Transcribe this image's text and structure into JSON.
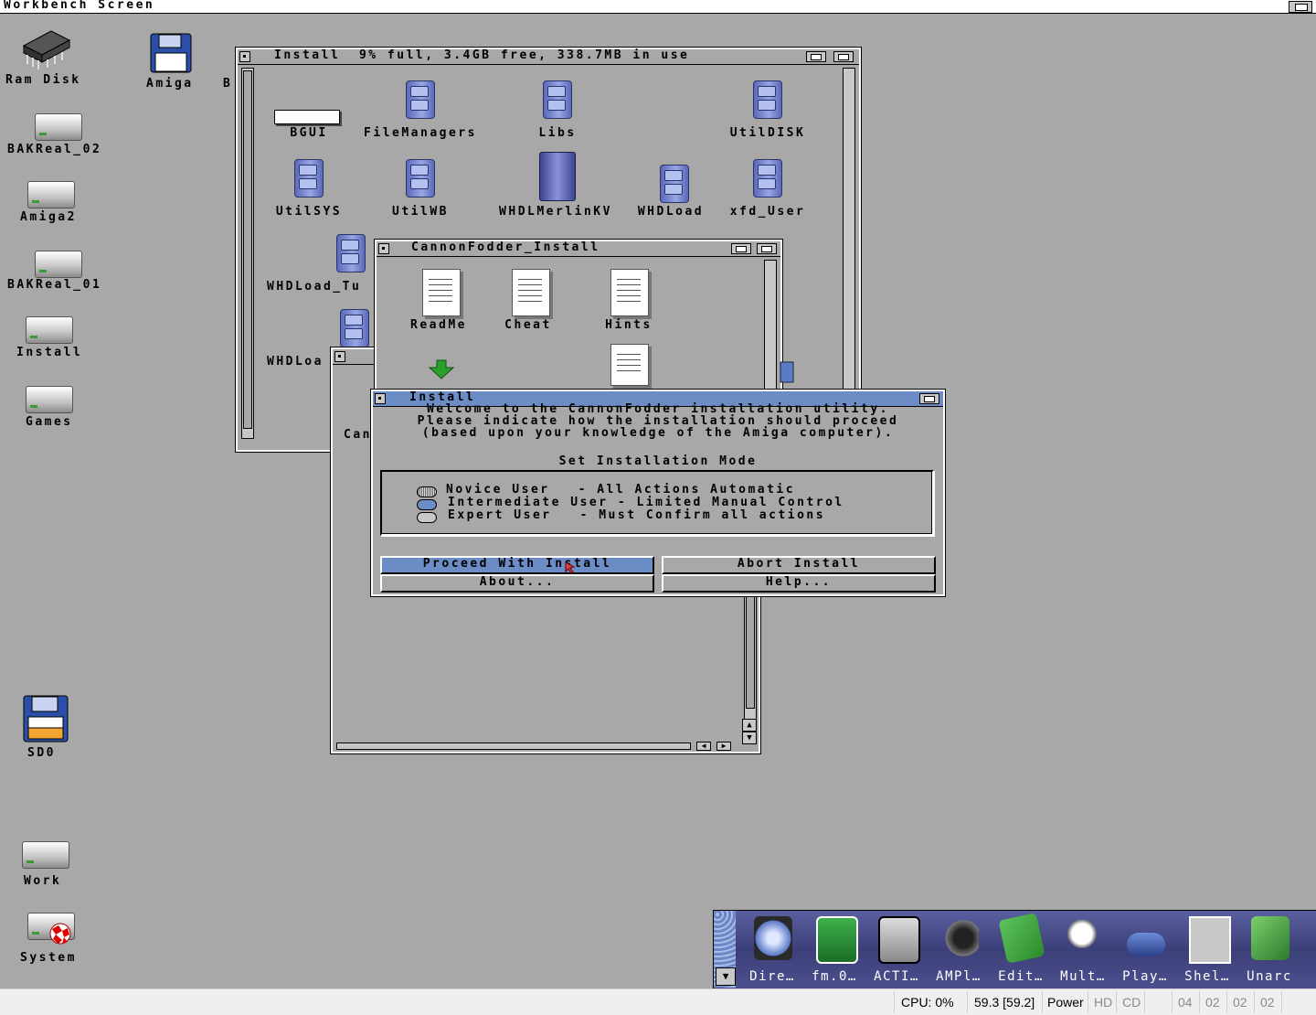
{
  "screen": {
    "title": "Workbench Screen"
  },
  "desktop_icons": {
    "ram_disk": "Ram Disk",
    "amiga": "Amiga",
    "b": "B",
    "bakreal_02": "BAKReal_02",
    "amiga2": "Amiga2",
    "bakreal_01": "BAKReal_01",
    "install": "Install",
    "games": "Games",
    "sd0": "SD0",
    "work": "Work",
    "system": "System"
  },
  "install_window": {
    "title": "Install  9% full, 3.4GB free, 338.7MB in use",
    "items": [
      "BGUI",
      "FileManagers",
      "Libs",
      "UtilDISK",
      "UtilSYS",
      "UtilWB",
      "WHDLMerlinKV",
      "WHDLoad",
      "xfd_User",
      "WHDLoad_Tu",
      "WHDLoa"
    ]
  },
  "cannon_window": {
    "title": "CannonFodder_Install",
    "items": [
      "ReadMe",
      "Cheat",
      "Hints"
    ]
  },
  "back_window": {
    "partial_label": "Can"
  },
  "dialog": {
    "title": "Install",
    "intro": [
      "Welcome to the CannonFodder installation utility.",
      "Please indicate how the installation should proceed",
      "(based upon your knowledge of the Amiga computer)."
    ],
    "group_title": "Set Installation Mode",
    "options": [
      {
        "label": "Novice User   - All Actions Automatic"
      },
      {
        "label": "Intermediate User - Limited Manual Control"
      },
      {
        "label": "Expert User   - Must Confirm all actions"
      }
    ],
    "selected_option": 1,
    "buttons": {
      "proceed": "Proceed With Install",
      "abort": "Abort Install",
      "about": "About...",
      "help": "Help..."
    }
  },
  "dock": {
    "items": [
      "Dire…",
      "fm.0…",
      "ACTI…",
      "AMPl…",
      "Edit…",
      "Mult…",
      "Play…",
      "Shel…",
      "Unarc"
    ]
  },
  "taskbar": {
    "cpu": "CPU: 0%",
    "fps": "59.3 [59.2]",
    "power": "Power",
    "hd": "HD",
    "cd": "CD",
    "drives": [
      "04",
      "02",
      "02",
      "02"
    ]
  },
  "colors": {
    "workbench_grey": "#a8a8a8",
    "active_blue": "#6b8cc4",
    "drawer_blue": "#7884d0"
  }
}
